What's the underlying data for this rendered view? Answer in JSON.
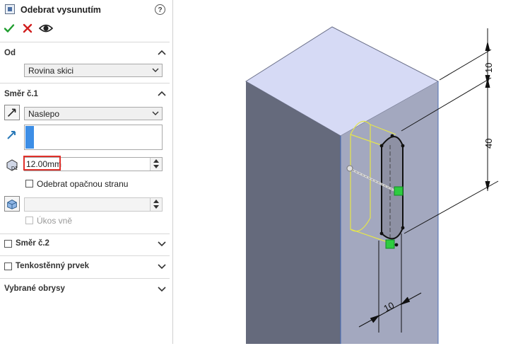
{
  "panel": {
    "title": "Odebrat vysunutím",
    "help_glyph": "?",
    "actions": {
      "ok_icon": "check-icon",
      "cancel_icon": "close-icon",
      "preview_icon": "eye-icon",
      "ok_color": "#1f9d2e",
      "cancel_color": "#d11f1f"
    },
    "od": {
      "header": "Od",
      "combo_value": "Rovina skici"
    },
    "smer1": {
      "header": "Směr č.1",
      "end_condition": "Naslepo",
      "depth_value": "12.00mm",
      "reverse_side_label": "Odebrat opačnou stranu",
      "reverse_side_checked": false,
      "draft_outward_label": "Úkos vně",
      "draft_outward_checked": false
    },
    "smer2": {
      "header": "Směr č.2",
      "checked": false
    },
    "thin": {
      "header": "Tenkostěnný prvek",
      "checked": false
    },
    "contours": {
      "header": "Vybrané obrysy"
    }
  },
  "viewport": {
    "dimensions": [
      "10",
      "40",
      "10"
    ],
    "colors": {
      "top_face": "#d6daf5",
      "left_face": "#656a7c",
      "right_face": "#a3a8bf",
      "sketch": "#111111",
      "preview": "#e6e64a",
      "handle": "#2ecc40",
      "selection": "#3d8ee6",
      "highlight": "#e0302a"
    }
  }
}
